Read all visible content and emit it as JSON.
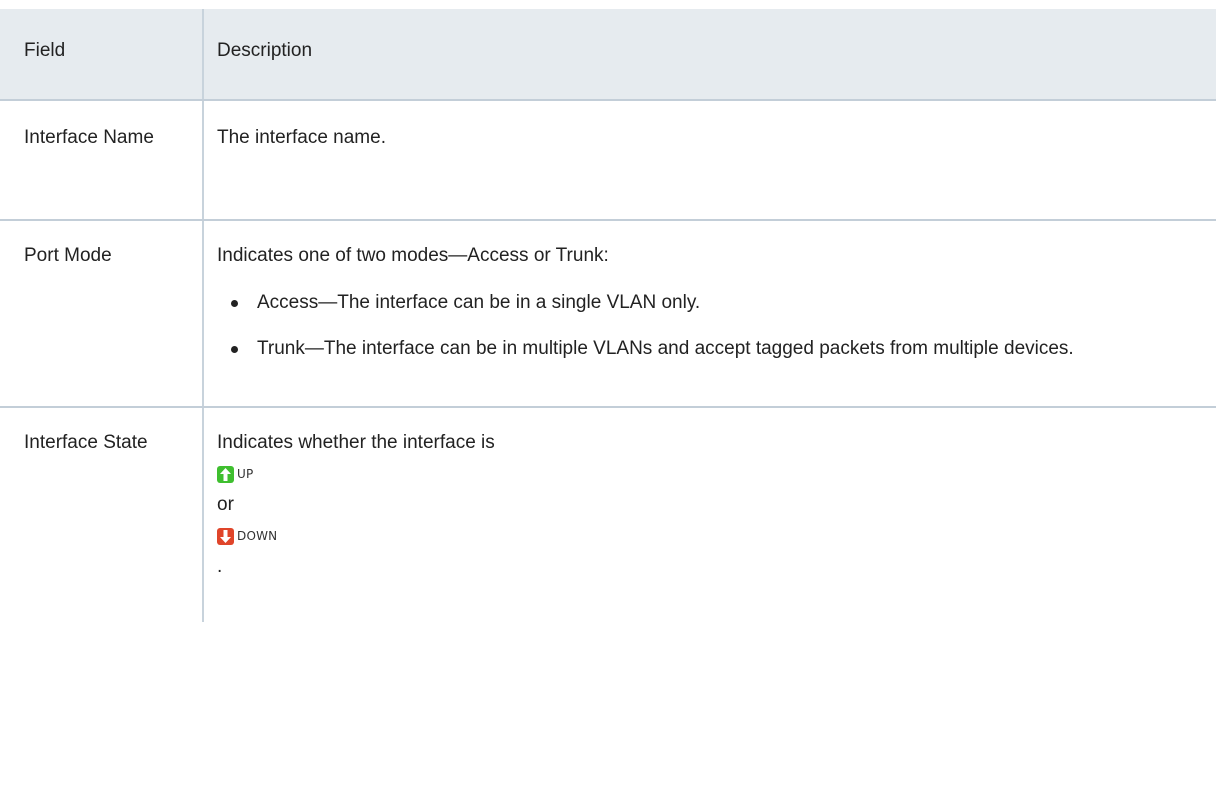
{
  "header": {
    "field": "Field",
    "description": "Description"
  },
  "rows": [
    {
      "field": "Interface Name",
      "description": "The interface name."
    },
    {
      "field": "Port Mode",
      "description": "Indicates one of two modes—Access or Trunk:",
      "bullets": [
        "Access—The interface can be in a single VLAN only.",
        "Trunk—The interface can be in multiple VLANs and accept tagged packets from multiple devices."
      ]
    },
    {
      "field": "Interface State",
      "description": "Indicates whether the interface is",
      "up_label": "UP",
      "up_icon": "arrow-up-icon",
      "connector": "or",
      "down_label": "DOWN",
      "down_icon": "arrow-down-icon",
      "trailing": "."
    }
  ],
  "colors": {
    "header_bg": "#e6ebef",
    "divider": "#c3ced8",
    "up_green": "#3fbf2f",
    "down_red": "#e0452a"
  }
}
